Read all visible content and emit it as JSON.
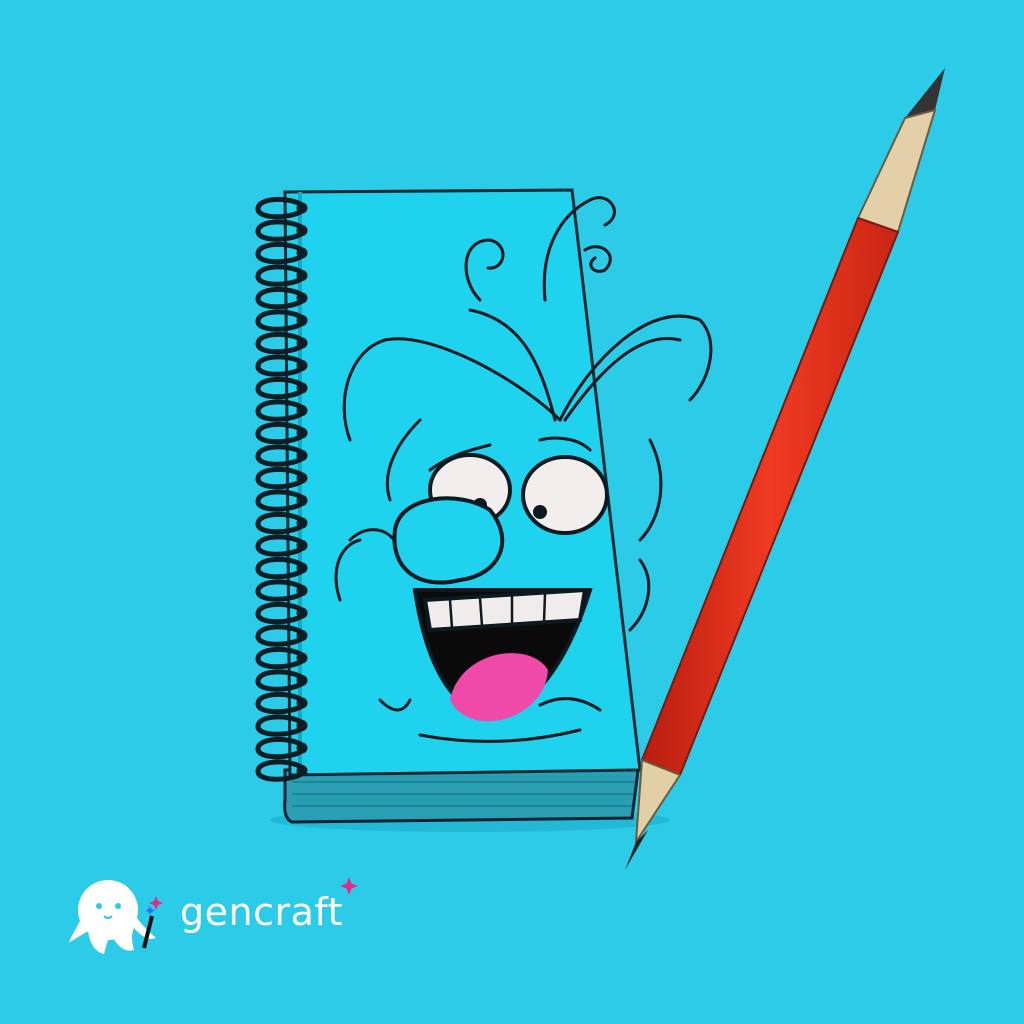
{
  "watermark": {
    "brand": "gencraft"
  },
  "colors": {
    "background": "#2ccbe8",
    "cover": "#1fd3ee",
    "pencil_body": "#e8321c",
    "tongue": "#f04aa8",
    "sparkle_pink": "#e8288a",
    "sparkle_blue": "#2f6df0"
  }
}
